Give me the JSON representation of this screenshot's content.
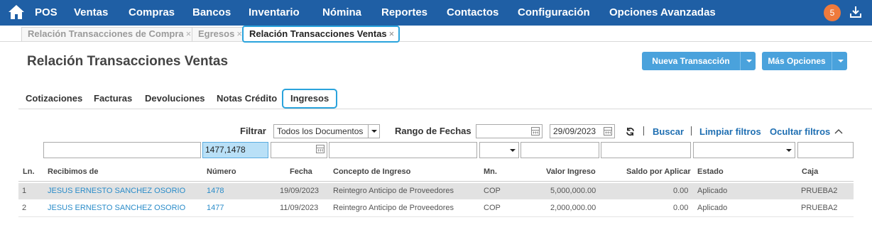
{
  "nav": {
    "items": [
      "POS",
      "Ventas",
      "Compras",
      "Bancos",
      "Inventario",
      "Nómina",
      "Reportes",
      "Contactos",
      "Configuración",
      "Opciones Avanzadas"
    ],
    "notification_count": "5",
    "accent": "#1f5fa5"
  },
  "doc_tabs": [
    {
      "label": "Relación Transacciones de Compra",
      "close": "×"
    },
    {
      "label": "Egresos",
      "close": "×"
    },
    {
      "label": "Relación Transacciones Ventas",
      "close": "×"
    }
  ],
  "page": {
    "title": "Relación Transacciones Ventas",
    "new_button": "Nueva Transacción",
    "more_button": "Más Opciones"
  },
  "subtabs": [
    "Cotizaciones",
    "Facturas",
    "Devoluciones",
    "Notas Crédito",
    "Ingresos"
  ],
  "filters": {
    "filter_label": "Filtrar",
    "filter_value": "Todos los Documentos",
    "date_range_label": "Rango de Fechas",
    "date_from": "",
    "date_to": "29/09/2023",
    "search": "Buscar",
    "clear": "Limpiar filtros",
    "hide": "Ocultar filtros"
  },
  "column_filters": {
    "numero": "1477,1478"
  },
  "table": {
    "headers": [
      "Ln.",
      "Recibimos de",
      "Número",
      "Fecha",
      "Concepto de Ingreso",
      "Mn.",
      "Valor Ingreso",
      "Saldo por Aplicar",
      "Estado",
      "Caja"
    ],
    "rows": [
      [
        "1",
        "JESUS ERNESTO SANCHEZ OSORIO",
        "1478",
        "19/09/2023",
        "Reintegro Anticipo de Proveedores",
        "COP",
        "5,000,000.00",
        "0.00",
        "Aplicado",
        "PRUEBA2"
      ],
      [
        "2",
        "JESUS ERNESTO SANCHEZ OSORIO",
        "1477",
        "11/09/2023",
        "Reintegro Anticipo de Proveedores",
        "COP",
        "2,000,000.00",
        "0.00",
        "Aplicado",
        "PRUEBA2"
      ]
    ]
  }
}
